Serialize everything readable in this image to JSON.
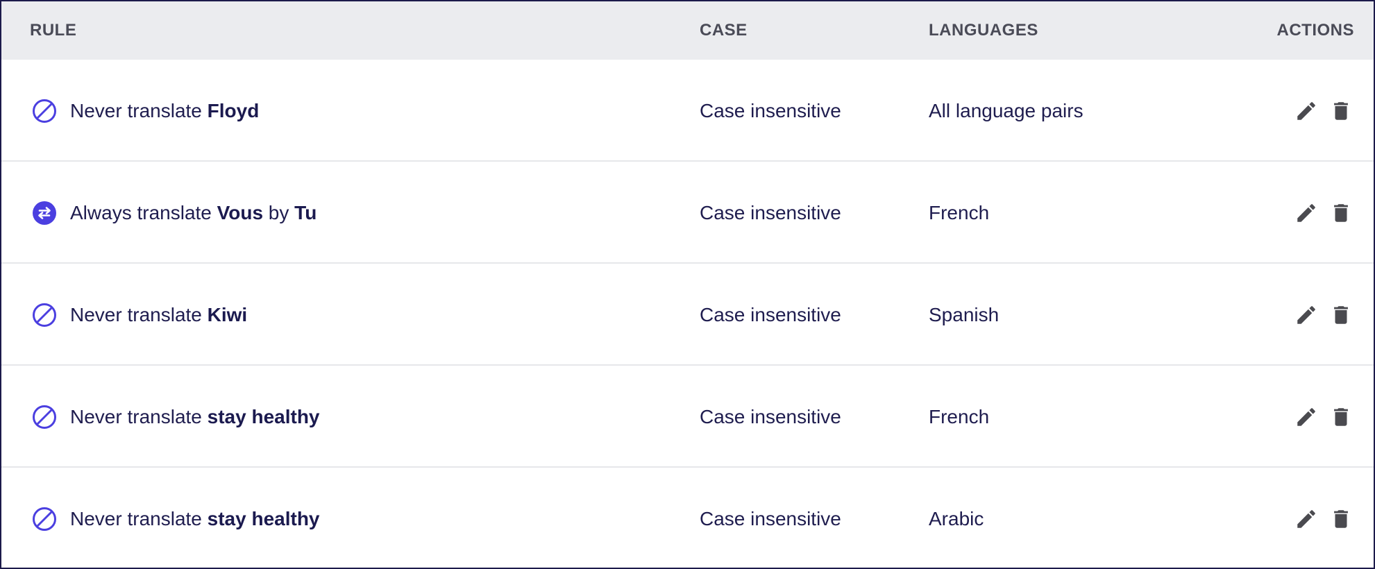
{
  "table": {
    "headers": {
      "rule": "RULE",
      "case": "CASE",
      "languages": "LANGUAGES",
      "actions": "ACTIONS"
    },
    "rows": [
      {
        "type": "never",
        "icon": "prohibit-icon",
        "prefix": "Never translate ",
        "term": "Floyd",
        "connector": "",
        "replacement": "",
        "case": "Case insensitive",
        "languages": "All language pairs"
      },
      {
        "type": "always",
        "icon": "swap-arrows-icon",
        "prefix": "Always translate ",
        "term": "Vous",
        "connector": " by ",
        "replacement": "Tu",
        "case": "Case insensitive",
        "languages": "French"
      },
      {
        "type": "never",
        "icon": "prohibit-icon",
        "prefix": "Never translate ",
        "term": "Kiwi",
        "connector": "",
        "replacement": "",
        "case": "Case insensitive",
        "languages": "Spanish"
      },
      {
        "type": "never",
        "icon": "prohibit-icon",
        "prefix": "Never translate ",
        "term": "stay healthy",
        "connector": "",
        "replacement": "",
        "case": "Case insensitive",
        "languages": "French"
      },
      {
        "type": "never",
        "icon": "prohibit-icon",
        "prefix": "Never translate ",
        "term": "stay healthy",
        "connector": "",
        "replacement": "",
        "case": "Case insensitive",
        "languages": "Arabic"
      }
    ],
    "actions": {
      "edit_icon": "pencil-icon",
      "delete_icon": "trash-icon"
    }
  },
  "colors": {
    "accent": "#4b3fe0",
    "text": "#1f1d4f",
    "header_bg": "#ebecef",
    "header_text": "#4a4b57",
    "action_icon": "#4a4a4f",
    "divider": "#e6e7ea"
  }
}
